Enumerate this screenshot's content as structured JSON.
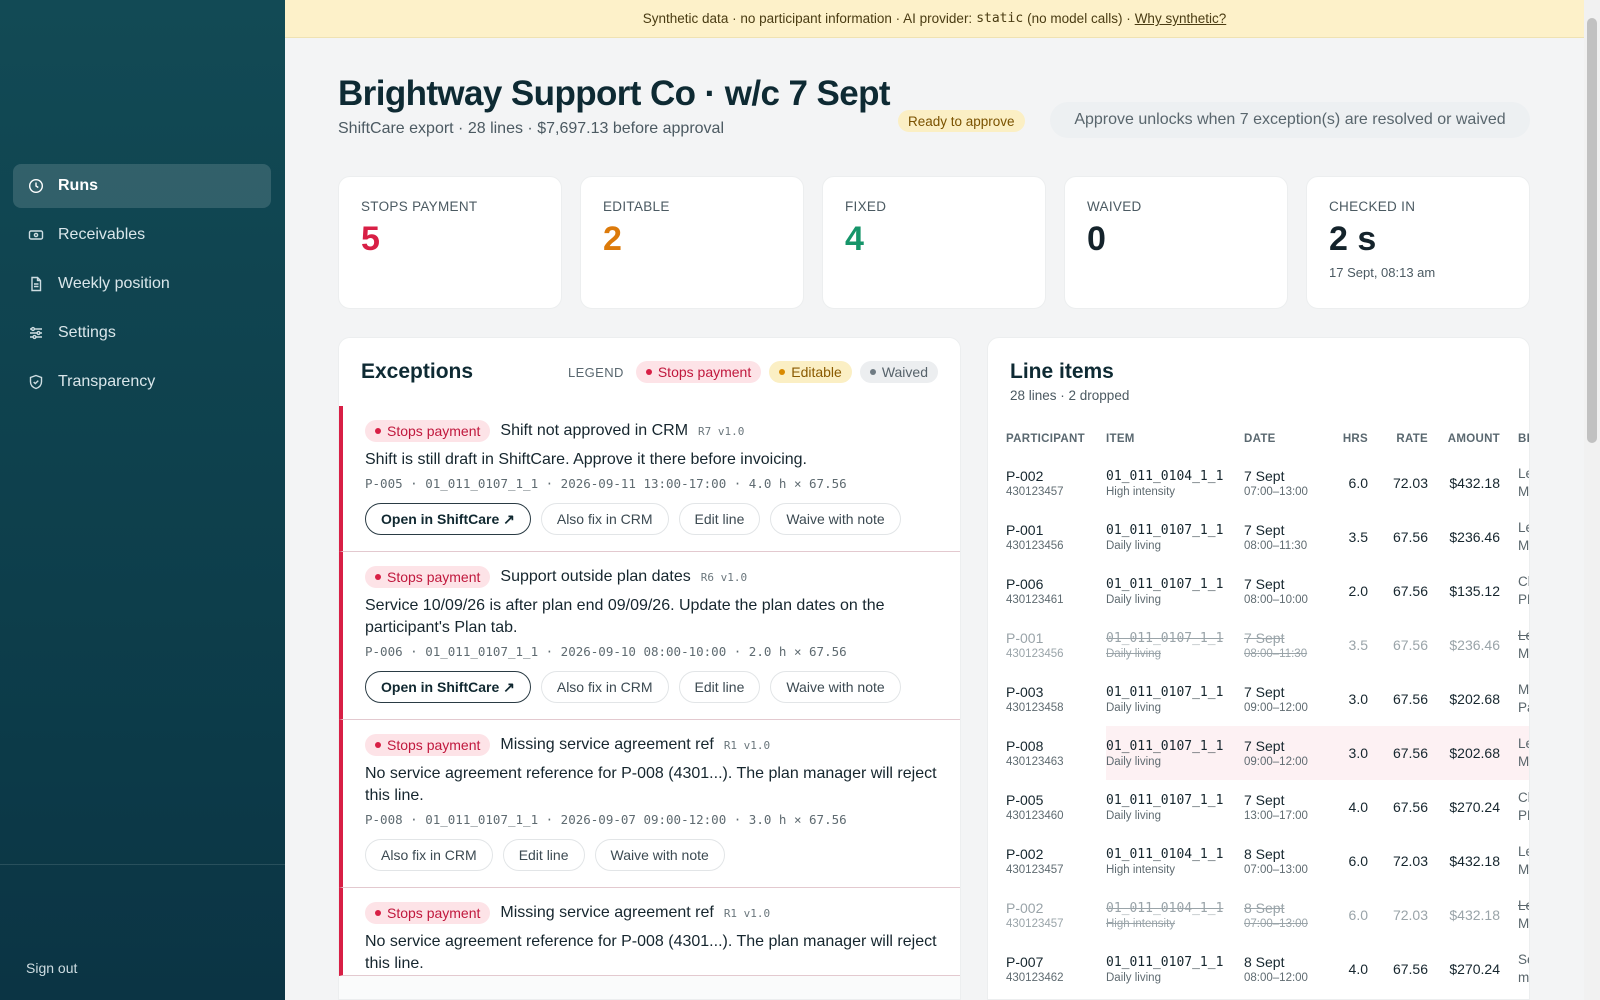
{
  "nav": {
    "items": [
      {
        "label": "Runs",
        "icon": "clock-icon",
        "active": true
      },
      {
        "label": "Receivables",
        "icon": "banknote-icon",
        "active": false
      },
      {
        "label": "Weekly position",
        "icon": "document-icon",
        "active": false
      },
      {
        "label": "Settings",
        "icon": "sliders-icon",
        "active": false
      },
      {
        "label": "Transparency",
        "icon": "shield-icon",
        "active": false
      }
    ],
    "signout": "Sign out"
  },
  "banner": {
    "prefix": "Synthetic data · no participant information · AI provider:",
    "provider": "static",
    "suffix": "(no model calls) ·",
    "link": "Why synthetic?"
  },
  "header": {
    "title": "Brightway Support Co · w/c 7 Sept",
    "subtitle": "ShiftCare export · 28 lines · $7,697.13 before approval",
    "status_badge": "Ready to approve",
    "approve_button": "Approve unlocks when 7 exception(s) are resolved or waived"
  },
  "stats": [
    {
      "label": "STOPS PAYMENT",
      "value": "5",
      "color": "#d81f45",
      "sub": ""
    },
    {
      "label": "EDITABLE",
      "value": "2",
      "color": "#dc7a0a",
      "sub": ""
    },
    {
      "label": "FIXED",
      "value": "4",
      "color": "#16956a",
      "sub": ""
    },
    {
      "label": "WAIVED",
      "value": "0",
      "color": "#14232b",
      "sub": ""
    },
    {
      "label": "CHECKED IN",
      "value": "2 s",
      "color": "#14232b",
      "sub": "17 Sept, 08:13 am"
    }
  ],
  "exceptions": {
    "title": "Exceptions",
    "legend_label": "LEGEND",
    "legend": {
      "stops": "Stops payment",
      "editable": "Editable",
      "waived": "Waived"
    },
    "items": [
      {
        "tag": "Stops payment",
        "title": "Shift not approved in CRM",
        "rule": "R7 v1.0",
        "description": "Shift is still draft in ShiftCare. Approve it there before invoicing.",
        "meta": "P-005 · 01_011_0107_1_1 · 2026-09-11 13:00-17:00 · 4.0 h × 67.56",
        "open_label": "Open in ShiftCare ↗",
        "fix_label": "Also fix in CRM",
        "edit_label": "Edit line",
        "waive_label": "Waive with note"
      },
      {
        "tag": "Stops payment",
        "title": "Support outside plan dates",
        "rule": "R6 v1.0",
        "description": "Service 10/09/26 is after plan end 09/09/26. Update the plan dates on the participant's Plan tab.",
        "meta": "P-006 · 01_011_0107_1_1 · 2026-09-10 08:00-10:00 · 2.0 h × 67.56",
        "open_label": "Open in ShiftCare ↗",
        "fix_label": "Also fix in CRM",
        "edit_label": "Edit line",
        "waive_label": "Waive with note"
      },
      {
        "tag": "Stops payment",
        "title": "Missing service agreement ref",
        "rule": "R1 v1.0",
        "description": "No service agreement reference for P-008 (4301...). The plan manager will reject this line.",
        "meta": "P-008 · 01_011_0107_1_1 · 2026-09-07 09:00-12:00 · 3.0 h × 67.56",
        "fix_label": "Also fix in CRM",
        "edit_label": "Edit line",
        "waive_label": "Waive with note"
      },
      {
        "tag": "Stops payment",
        "title": "Missing service agreement ref",
        "rule": "R1 v1.0",
        "description": "No service agreement reference for P-008 (4301...). The plan manager will reject this line."
      }
    ]
  },
  "line_items": {
    "title": "Line items",
    "subtitle": "28 lines · 2 dropped",
    "columns": [
      "PARTICIPANT",
      "ITEM",
      "DATE",
      "HRS",
      "RATE",
      "AMOUNT",
      "BILL"
    ],
    "rows": [
      {
        "pid": "P-002",
        "ndis": "430123457",
        "item": "01_011_0104_1_1",
        "item_desc": "High intensity",
        "date": "7 Sept",
        "time": "07:00–13:00",
        "hrs": "6.0",
        "rate": "72.03",
        "amount": "$432.18",
        "bill1": "Leap",
        "bill2": "Man",
        "dropped": false,
        "highlight": false
      },
      {
        "pid": "P-001",
        "ndis": "430123456",
        "item": "01_011_0107_1_1",
        "item_desc": "Daily living",
        "date": "7 Sept",
        "time": "08:00–11:30",
        "hrs": "3.5",
        "rate": "67.56",
        "amount": "$236.46",
        "bill1": "Leap",
        "bill2": "Man",
        "dropped": false,
        "highlight": false
      },
      {
        "pid": "P-006",
        "ndis": "430123461",
        "item": "01_011_0107_1_1",
        "item_desc": "Daily living",
        "date": "7 Sept",
        "time": "08:00–10:00",
        "hrs": "2.0",
        "rate": "67.56",
        "amount": "$135.12",
        "bill1": "Clea",
        "bill2": "PM",
        "dropped": false,
        "highlight": false
      },
      {
        "pid": "P-001",
        "ndis": "430123456",
        "item": "01_011_0107_1_1",
        "item_desc": "Daily living",
        "date": "7 Sept",
        "time": "08:00–11:30",
        "hrs": "3.5",
        "rate": "67.56",
        "amount": "$236.46",
        "bill1": "Leap",
        "bill2": "Man",
        "dropped": true,
        "highlight": false
      },
      {
        "pid": "P-003",
        "ndis": "430123458",
        "item": "01_011_0107_1_1",
        "item_desc": "Daily living",
        "date": "7 Sept",
        "time": "09:00–12:00",
        "hrs": "3.0",
        "rate": "67.56",
        "amount": "$202.68",
        "bill1": "MyP",
        "bill2": "Partı",
        "dropped": false,
        "highlight": false
      },
      {
        "pid": "P-008",
        "ndis": "430123463",
        "item": "01_011_0107_1_1",
        "item_desc": "Daily living",
        "date": "7 Sept",
        "time": "09:00–12:00",
        "hrs": "3.0",
        "rate": "67.56",
        "amount": "$202.68",
        "bill1": "Leap",
        "bill2": "Man",
        "dropped": false,
        "highlight": true
      },
      {
        "pid": "P-005",
        "ndis": "430123460",
        "item": "01_011_0107_1_1",
        "item_desc": "Daily living",
        "date": "7 Sept",
        "time": "13:00–17:00",
        "hrs": "4.0",
        "rate": "67.56",
        "amount": "$270.24",
        "bill1": "Clea",
        "bill2": "PM",
        "dropped": false,
        "highlight": false
      },
      {
        "pid": "P-002",
        "ndis": "430123457",
        "item": "01_011_0104_1_1",
        "item_desc": "High intensity",
        "date": "8 Sept",
        "time": "07:00–13:00",
        "hrs": "6.0",
        "rate": "72.03",
        "amount": "$432.18",
        "bill1": "Leap",
        "bill2": "Man",
        "dropped": false,
        "highlight": false
      },
      {
        "pid": "P-002",
        "ndis": "430123457",
        "item": "01_011_0104_1_1",
        "item_desc": "High intensity",
        "date": "8 Sept",
        "time": "07:00–13:00",
        "hrs": "6.0",
        "rate": "72.03",
        "amount": "$432.18",
        "bill1": "Leap",
        "bill2": "Man",
        "dropped": true,
        "highlight": false
      },
      {
        "pid": "P-007",
        "ndis": "430123462",
        "item": "01_011_0107_1_1",
        "item_desc": "Daily living",
        "date": "8 Sept",
        "time": "08:00–12:00",
        "hrs": "4.0",
        "rate": "67.56",
        "amount": "$270.24",
        "bill1": "Self-",
        "bill2": "man",
        "dropped": false,
        "highlight": false
      }
    ]
  }
}
